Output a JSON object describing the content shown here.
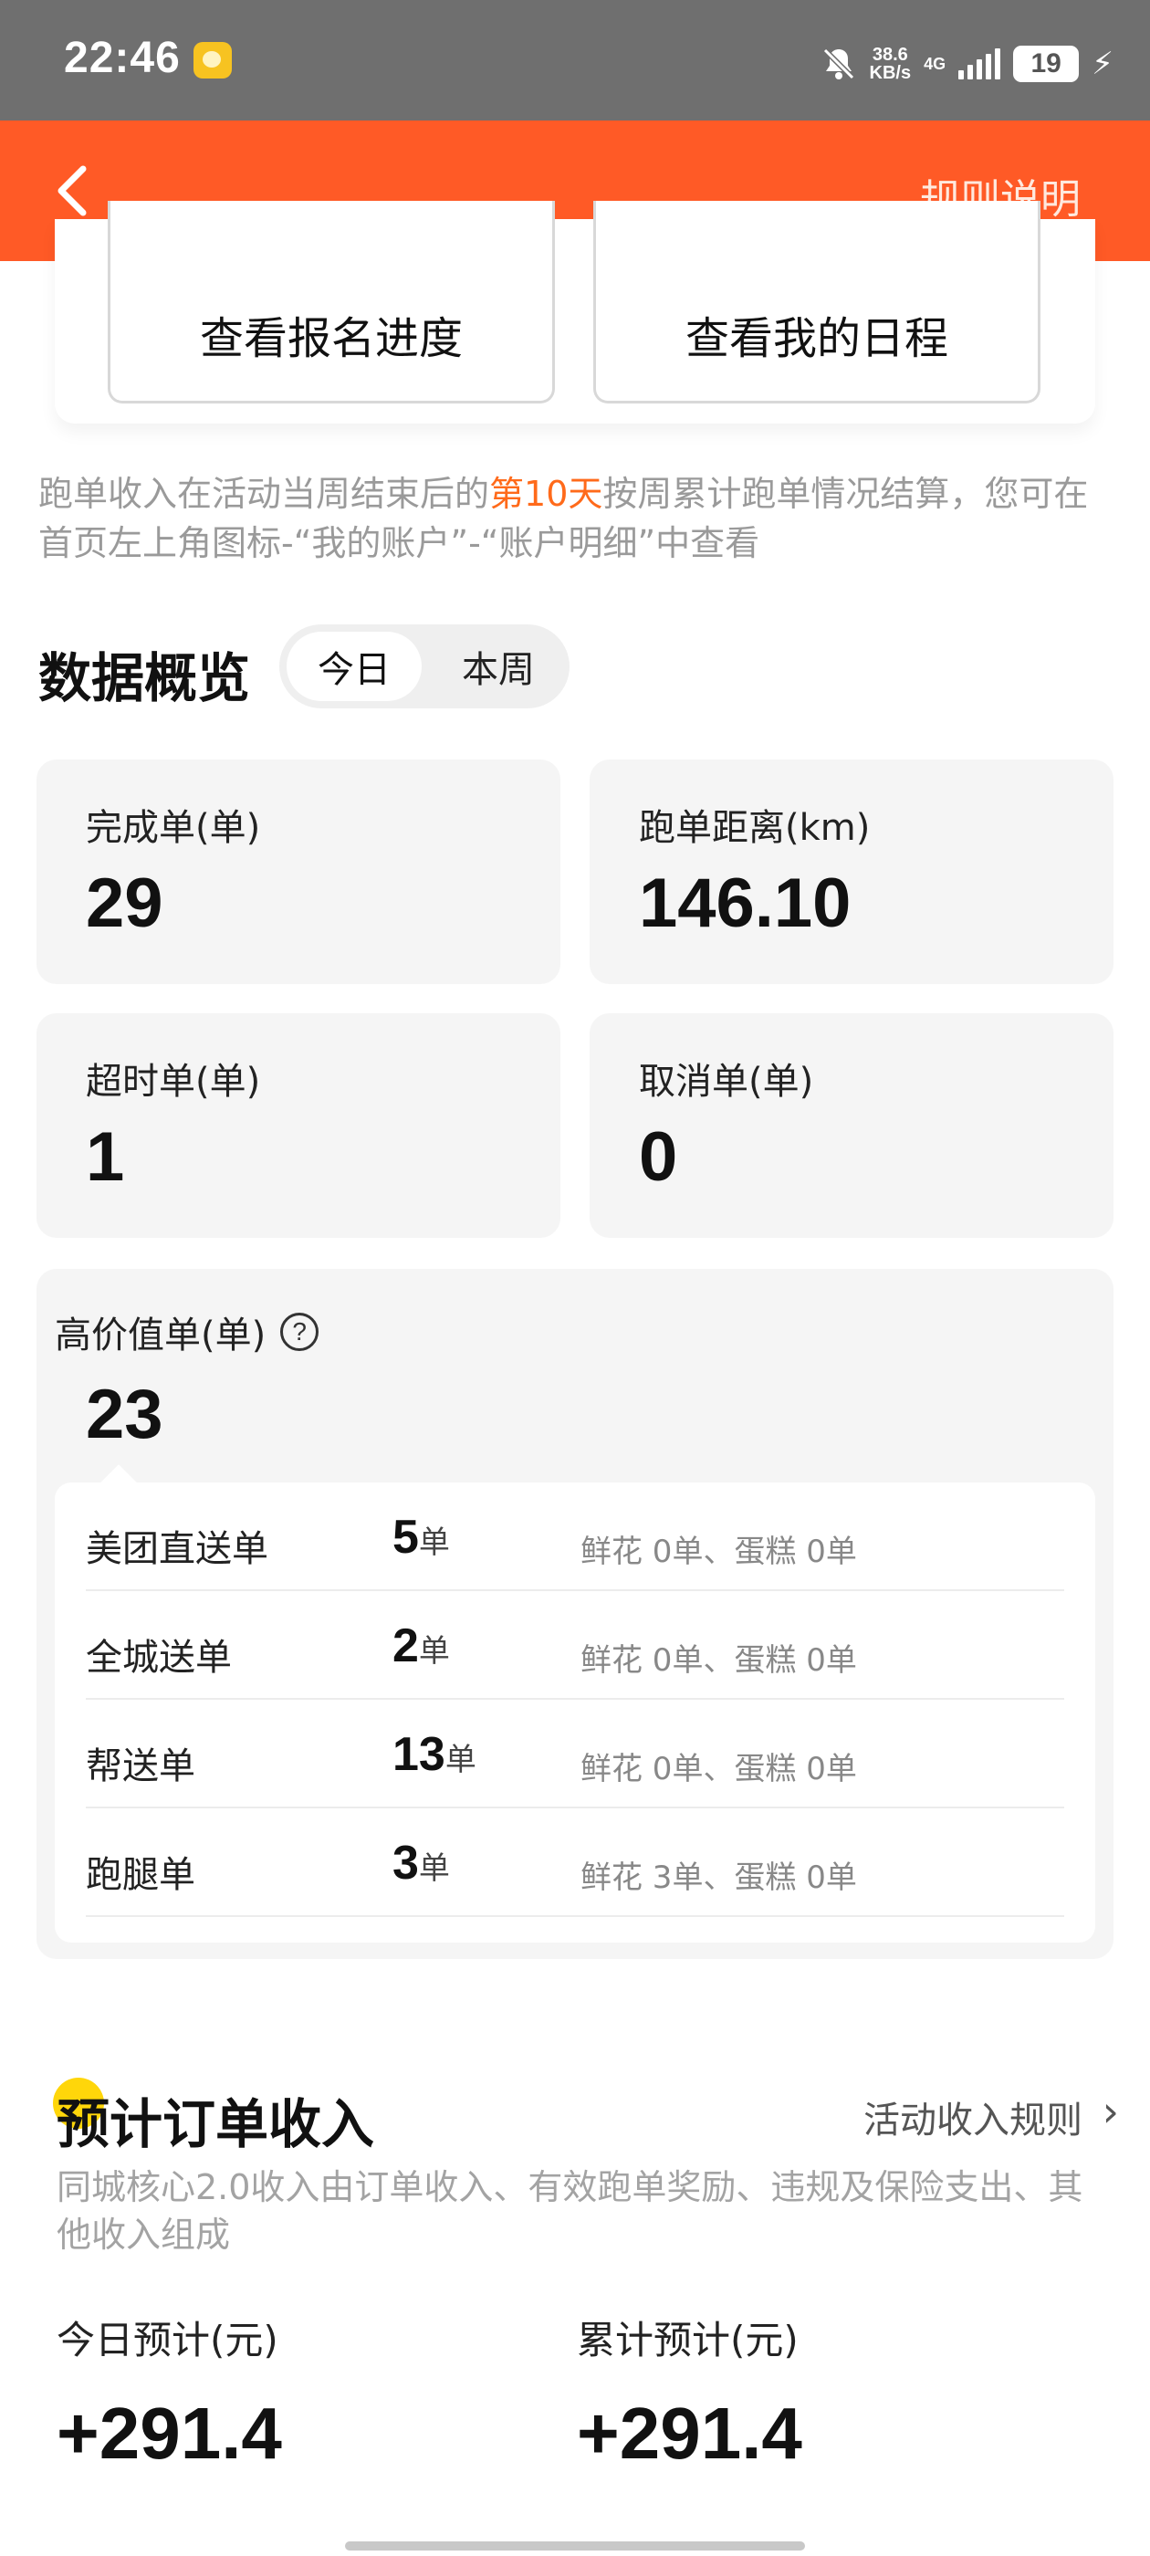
{
  "status_bar": {
    "time": "22:46",
    "speed_value": "38.6",
    "speed_unit": "KB/s",
    "network": "4G",
    "battery": "19"
  },
  "header": {
    "rules_label": "规则说明"
  },
  "top_buttons": {
    "registration_progress": "查看报名进度",
    "my_schedule": "查看我的日程"
  },
  "notice": {
    "part1": "跑单收入在活动当周结束后的",
    "highlight": "第10天",
    "part2": "按周累计跑单情况结算，您可在首页左上角图标-“我的账户”-“账户明细”中查看"
  },
  "overview": {
    "title": "数据概览",
    "tabs": [
      "今日",
      "本周"
    ],
    "stats": [
      {
        "label": "完成单(单)",
        "value": "29"
      },
      {
        "label": "跑单距离(km)",
        "value": "146.10"
      },
      {
        "label": "超时单(单)",
        "value": "1"
      },
      {
        "label": "取消单(单)",
        "value": "0"
      }
    ]
  },
  "high_value": {
    "label": "高价值单(单)",
    "value": "23",
    "rows": [
      {
        "name": "美团直送单",
        "count": "5",
        "unit": "单",
        "extra": "鲜花 0单、蛋糕 0单"
      },
      {
        "name": "全城送单",
        "count": "2",
        "unit": "单",
        "extra": "鲜花 0单、蛋糕 0单"
      },
      {
        "name": "帮送单",
        "count": "13",
        "unit": "单",
        "extra": "鲜花 0单、蛋糕 0单"
      },
      {
        "name": "跑腿单",
        "count": "3",
        "unit": "单",
        "extra": "鲜花 3单、蛋糕 0单"
      }
    ]
  },
  "income": {
    "title": "预计订单收入",
    "rules_link": "活动收入规则",
    "description": "同城核心2.0收入由订单收入、有效跑单奖励、违规及保险支出、其他收入组成",
    "today_label": "今日预计(元)",
    "today_value": "+291.4",
    "total_label": "累计预计(元)",
    "total_value": "+291.4"
  },
  "colors": {
    "header": "#ff5a26",
    "highlight": "#ff6a1a",
    "card_bg": "#f5f5f5"
  }
}
